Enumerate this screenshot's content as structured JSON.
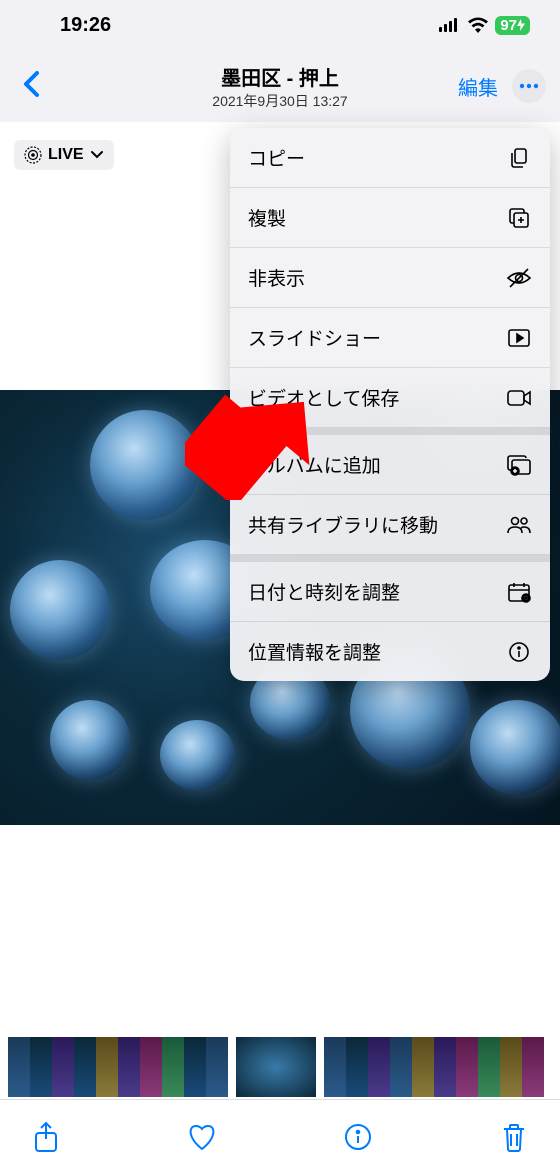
{
  "status": {
    "time": "19:26",
    "battery": "97"
  },
  "nav": {
    "title": "墨田区 - 押上",
    "subtitle": "2021年9月30日 13:27",
    "edit": "編集"
  },
  "live": "LIVE",
  "menu": {
    "copy": "コピー",
    "duplicate": "複製",
    "hide": "非表示",
    "slideshow": "スライドショー",
    "save_video": "ビデオとして保存",
    "add_album": "アルバムに追加",
    "move_shared": "共有ライブラリに移動",
    "adjust_date": "日付と時刻を調整",
    "adjust_location": "位置情報を調整"
  }
}
